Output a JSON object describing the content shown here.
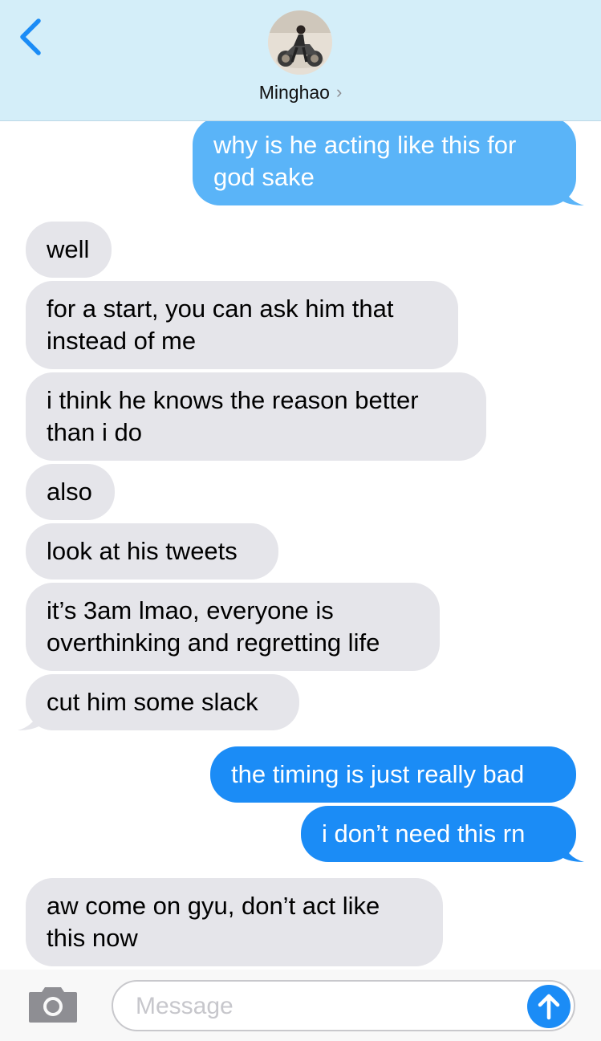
{
  "header": {
    "contact_name": "Minghao",
    "chevron": "›"
  },
  "messages": [
    {
      "side": "outgoing",
      "text": "why is he acting like this for\ngod sake"
    },
    {
      "side": "incoming",
      "text": "well"
    },
    {
      "side": "incoming",
      "text": "for a start, you can ask him that\ninstead of me"
    },
    {
      "side": "incoming",
      "text": "i think he knows the reason better\nthan i do"
    },
    {
      "side": "incoming",
      "text": "also"
    },
    {
      "side": "incoming",
      "text": "look at his tweets"
    },
    {
      "side": "incoming",
      "text": "it’s 3am lmao, everyone is\noverthinking and regretting life"
    },
    {
      "side": "incoming",
      "text": "cut him some slack"
    },
    {
      "side": "outgoing",
      "text": "the timing is just really bad"
    },
    {
      "side": "outgoing",
      "text": "i don’t need this rn"
    },
    {
      "side": "incoming",
      "text": "aw come on gyu, don’t act like\nthis now"
    }
  ],
  "composer": {
    "placeholder": "Message",
    "value": ""
  },
  "icons": {
    "back": "chevron-left-icon",
    "camera": "camera-icon",
    "send": "arrow-up-icon"
  },
  "colors": {
    "header_bg": "#d4eef9",
    "incoming_bubble": "#e5e5ea",
    "outgoing_bubble": "#1b8cf6",
    "outgoing_bubble_faded": "#5ab4f8",
    "accent": "#1b8cf6"
  }
}
